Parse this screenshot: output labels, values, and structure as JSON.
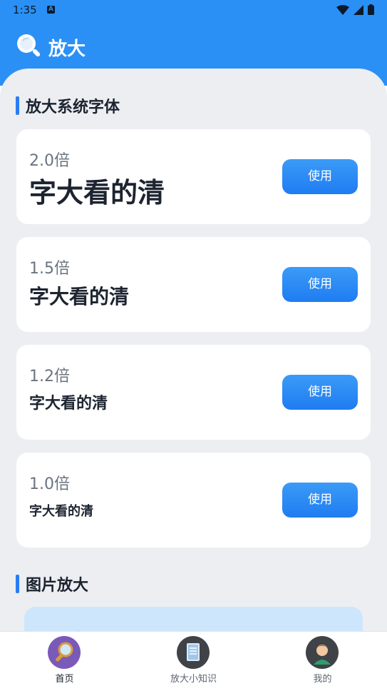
{
  "status_bar": {
    "time": "1:35",
    "indicator": "A"
  },
  "app_bar": {
    "title": "放大"
  },
  "sections": {
    "system_font": "放大系统字体",
    "image_zoom": "图片放大"
  },
  "font_options": [
    {
      "scale": "2.0倍",
      "sample": "字大看的清",
      "button": "使用"
    },
    {
      "scale": "1.5倍",
      "sample": "字大看的清",
      "button": "使用"
    },
    {
      "scale": "1.2倍",
      "sample": "字大看的清",
      "button": "使用"
    },
    {
      "scale": "1.0倍",
      "sample": "字大看的清",
      "button": "使用"
    }
  ],
  "tabs": [
    {
      "label": "首页",
      "icon": "magnifier-icon",
      "active": true
    },
    {
      "label": "放大小知识",
      "icon": "notebook-icon",
      "active": false
    },
    {
      "label": "我的",
      "icon": "user-avatar-icon",
      "active": false
    }
  ],
  "colors": {
    "primary": "#2a90f5",
    "button": "#1f7cf2",
    "background": "#eceef2"
  }
}
